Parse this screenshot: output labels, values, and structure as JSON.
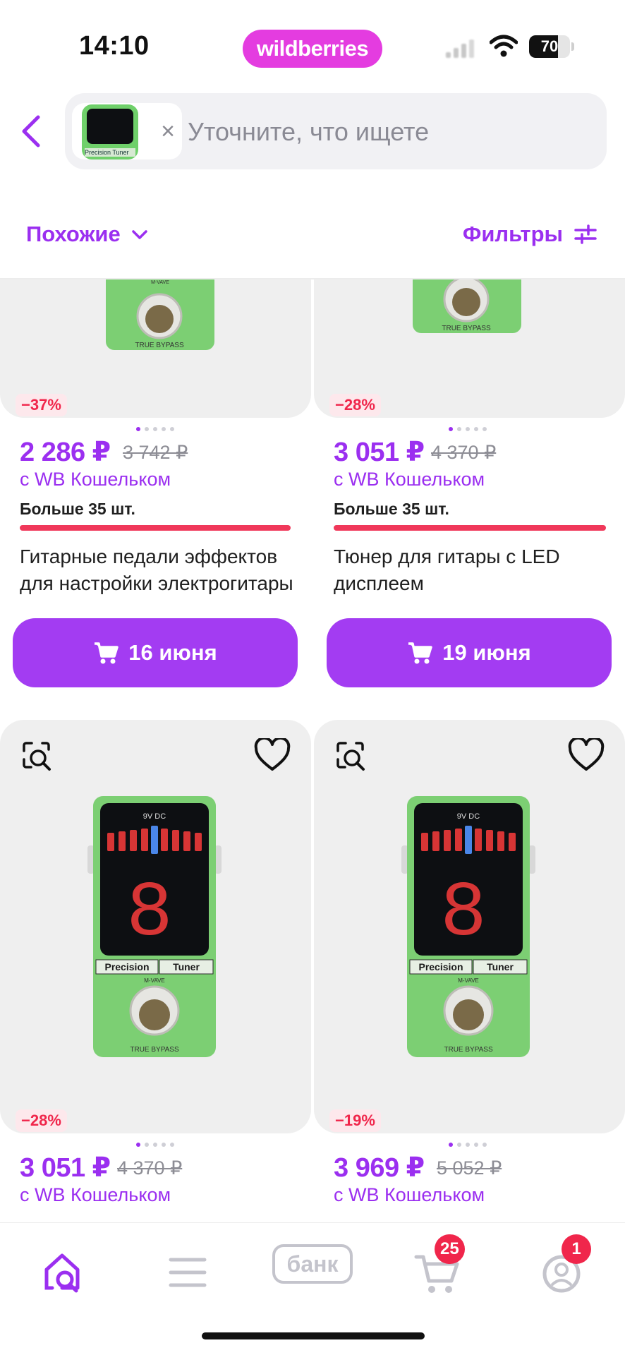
{
  "status_bar": {
    "time": "14:10",
    "brand": "wildberries",
    "battery": "70",
    "battery_level": 0.7
  },
  "search": {
    "placeholder": "Уточните, что ищете",
    "thumb_label": "Precision Tuner"
  },
  "toolbar": {
    "similar_label": "Похожие",
    "filters_label": "Фильтры"
  },
  "products": [
    {
      "discount": "−37%",
      "price": "2 286 ₽",
      "old_price": "3 742 ₽",
      "wallet": "с WB Кошельком",
      "stock": "Больше 35 шт.",
      "title_line1": "Гитарные педали эффектов",
      "title_line2": "для настройки электрогитары",
      "delivery": "16 июня"
    },
    {
      "discount": "−28%",
      "price": "3 051 ₽",
      "old_price": "4 370 ₽",
      "wallet": "с WB Кошельком",
      "stock": "Больше 35 шт.",
      "title_line1": "Тюнер для гитары с LED",
      "title_line2": "дисплеем",
      "delivery": "19 июня"
    },
    {
      "discount": "−28%",
      "price": "3 051 ₽",
      "old_price": "4 370 ₽",
      "wallet": "с WB Кошельком"
    },
    {
      "discount": "−19%",
      "price": "3 969 ₽",
      "old_price": "5 052 ₽",
      "wallet": "с WB Кошельком"
    }
  ],
  "pedal": {
    "label_left": "Precision",
    "label_right": "Tuner",
    "brand": "M-VAVE",
    "bypass": "TRUE BYPASS",
    "power": "9V DC",
    "digit": "8"
  },
  "nav": {
    "bank_label": "банк",
    "cart_badge": "25",
    "profile_badge": "1"
  },
  "colors": {
    "accent": "#9b2ff0",
    "brand": "#e43ce0",
    "discount": "#f0264b",
    "button": "#a33cf2"
  },
  "icons": [
    "back-chevron-icon",
    "close-icon",
    "chevron-down-icon",
    "filters-sliders-icon",
    "cart-icon",
    "visual-search-icon",
    "heart-icon",
    "home-search-icon",
    "menu-icon",
    "profile-icon"
  ]
}
